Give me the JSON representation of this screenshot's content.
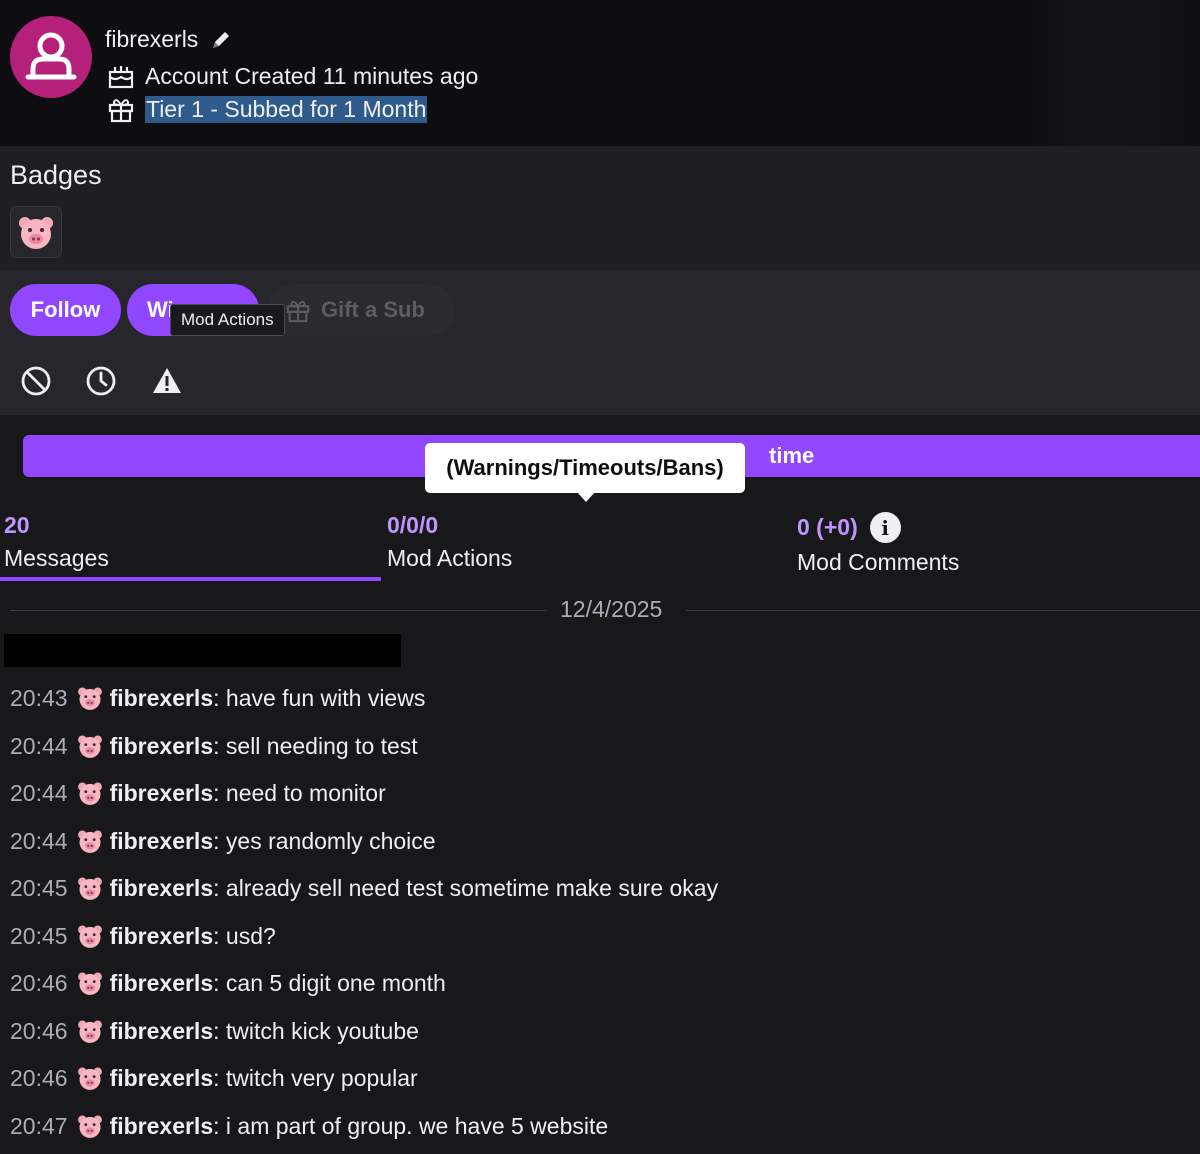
{
  "header": {
    "username": "fibrexerls",
    "account_created": "Account Created 11 minutes ago",
    "subscription": "Tier 1 - Subbed for 1 Month"
  },
  "badges": {
    "title": "Badges"
  },
  "actions": {
    "follow_label": "Follow",
    "whisper_label": "Wi",
    "gift_label": "Gift a Sub",
    "tooltip_mod_actions": "Mod Actions"
  },
  "timeout_bar": {
    "visible_text": "time",
    "tooltip": "(Warnings/Timeouts/Bans)"
  },
  "stats": [
    {
      "value": "20",
      "label": "Messages"
    },
    {
      "value": "0/0/0",
      "label": "Mod Actions"
    },
    {
      "value": "0 (+0)",
      "label": "Mod Comments"
    }
  ],
  "date_divider": "12/4/2025",
  "messages": [
    {
      "time": "20:43",
      "user": "fibrexerls",
      "text": ": have fun with views"
    },
    {
      "time": "20:44",
      "user": "fibrexerls",
      "text": ": sell needing to test"
    },
    {
      "time": "20:44",
      "user": "fibrexerls",
      "text": ": need to monitor"
    },
    {
      "time": "20:44",
      "user": "fibrexerls",
      "text": ": yes randomly choice"
    },
    {
      "time": "20:45",
      "user": "fibrexerls",
      "text": ": already sell need test sometime make sure okay"
    },
    {
      "time": "20:45",
      "user": "fibrexerls",
      "text": ": usd?"
    },
    {
      "time": "20:46",
      "user": "fibrexerls",
      "text": ": can 5 digit one month"
    },
    {
      "time": "20:46",
      "user": "fibrexerls",
      "text": ": twitch kick youtube"
    },
    {
      "time": "20:46",
      "user": "fibrexerls",
      "text": ": twitch very popular"
    },
    {
      "time": "20:47",
      "user": "fibrexerls",
      "text": ": i am part of group. we have 5 website"
    }
  ],
  "colors": {
    "accent": "#9147ff",
    "accent_text": "#bf94ff",
    "avatar_bg": "#b5207a"
  },
  "icons": [
    "avatar-user-icon",
    "edit-pencil-icon",
    "cake-icon",
    "gift-icon",
    "pig-badge-icon",
    "ban-icon",
    "timeout-clock-icon",
    "warning-icon",
    "info-icon"
  ]
}
